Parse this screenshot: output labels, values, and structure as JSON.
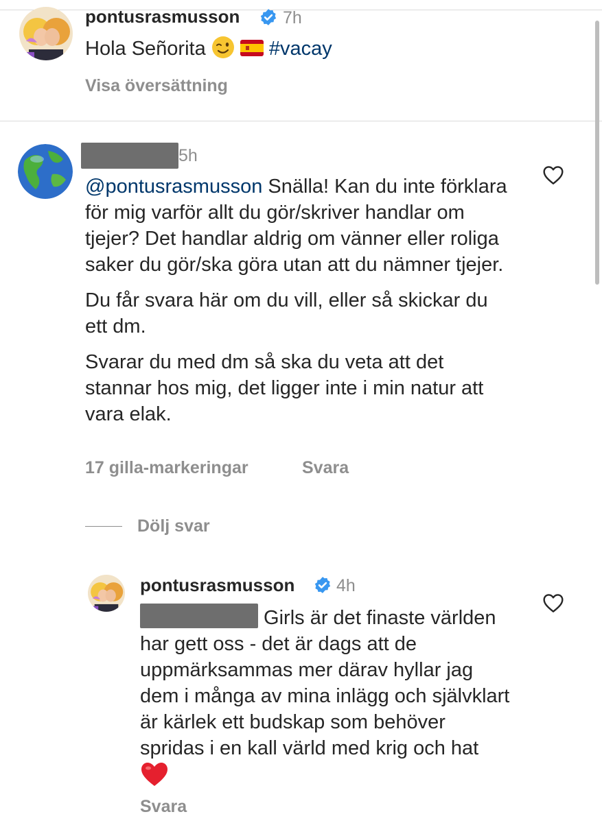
{
  "post": {
    "username": "pontusrasmusson",
    "time": "7h",
    "caption_text": "Hola Señorita",
    "caption_hashtag": "#vacay",
    "translate_label": "Visa översättning"
  },
  "comment": {
    "time": "5h",
    "mention": "@pontusrasmusson",
    "paragraph1": " Snälla! Kan du inte förklara för mig varför allt du gör/skriver handlar om tjejer? Det handlar aldrig om vänner eller roliga saker du gör/ska göra utan att du nämner tjejer.",
    "paragraph2": "Du får svara här om du vill, eller så skickar du ett dm.",
    "paragraph3": "Svarar du med dm så ska du veta att det stannar hos mig, det ligger inte i min natur att vara elak.",
    "likes_label": "17 gilla-markeringar",
    "reply_label": "Svara",
    "hide_replies_label": "Dölj svar"
  },
  "reply": {
    "username": "pontusrasmusson",
    "time": "4h",
    "text": " Girls är det finaste världen har gett oss - det är dags att de uppmärksammas mer därav hyllar jag dem i många av mina inlägg och självklart är kärlek ett budskap som behöver spridas i en kall värld med krig och hat ",
    "reply_label": "Svara"
  },
  "colors": {
    "link": "#00376b",
    "muted": "#8e8e8e",
    "verified": "#3897f0",
    "text": "#262626"
  },
  "icons": {
    "verified": "verified-badge-icon",
    "like": "heart-outline-icon",
    "wink": "winking-face-emoji",
    "flag": "spain-flag-emoji",
    "heart": "red-heart-emoji"
  }
}
